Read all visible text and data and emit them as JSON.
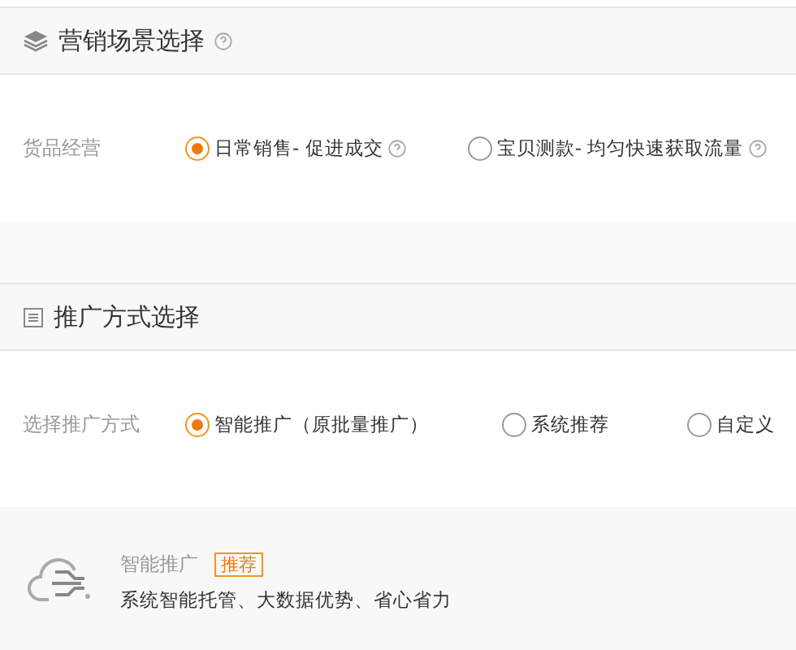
{
  "sections": [
    {
      "title": "营销场景选择",
      "help": true,
      "field": {
        "label": "货品经营",
        "options": [
          {
            "label": "日常销售- 促进成交",
            "selected": true,
            "help": true
          },
          {
            "label": "宝贝测款- 均匀快速获取流量",
            "selected": false,
            "help": true
          }
        ]
      }
    },
    {
      "title": "推广方式选择",
      "help": false,
      "field": {
        "label": "选择推广方式",
        "options": [
          {
            "label": "智能推广（原批量推广）",
            "selected": true,
            "help": false
          },
          {
            "label": "系统推荐",
            "selected": false,
            "help": false
          },
          {
            "label": "自定义",
            "selected": false,
            "help": false
          }
        ]
      }
    }
  ],
  "card": {
    "title": "智能推广",
    "badge": "推荐",
    "description": "系统智能托管、大数据优势、省心省力"
  }
}
